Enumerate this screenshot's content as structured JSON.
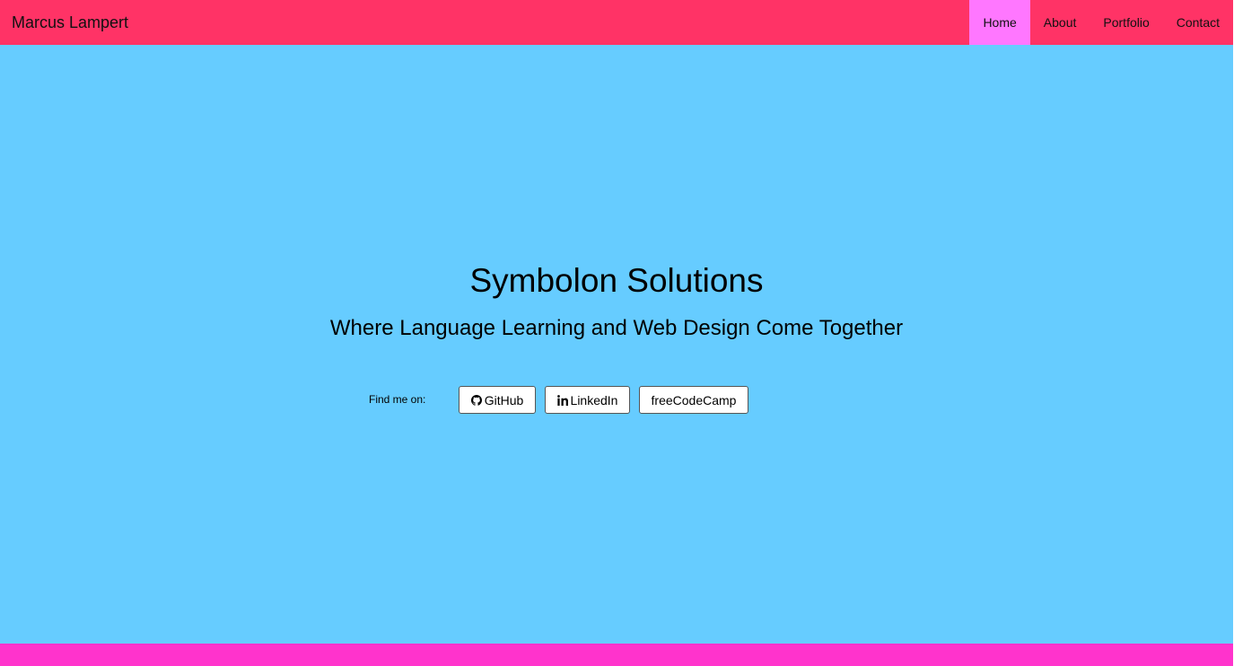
{
  "navbar": {
    "brand": "Marcus Lampert",
    "items": [
      {
        "label": "Home",
        "active": true
      },
      {
        "label": "About",
        "active": false
      },
      {
        "label": "Portfolio",
        "active": false
      },
      {
        "label": "Contact",
        "active": false
      }
    ]
  },
  "hero": {
    "title": "Symbolon Solutions",
    "subtitle": "Where Language Learning and Web Design Come Together",
    "find_label": "Find me on:",
    "links": [
      {
        "label": "GitHub",
        "icon": "github-icon"
      },
      {
        "label": "LinkedIn",
        "icon": "linkedin-icon"
      },
      {
        "label": "freeCodeCamp",
        "icon": ""
      }
    ]
  },
  "colors": {
    "navbar": "#ff3366",
    "nav_active": "#ff77ff",
    "hero_background": "#66ccff",
    "footer": "#ff33cc"
  }
}
